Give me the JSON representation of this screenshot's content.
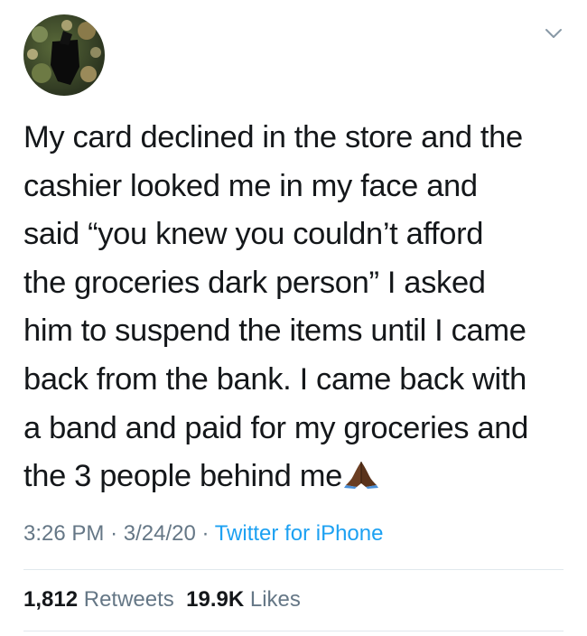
{
  "tweet": {
    "lines": [
      "My card declined in the store and the",
      "cashier looked me in my face and",
      "said “you knew you couldn’t afford",
      "the groceries dark person” I asked",
      "him to suspend the items until I came",
      "back from the bank. I came back with",
      "a band and paid for my groceries and",
      "the 3 people behind me"
    ],
    "emoji": "folded-hands-emoji"
  },
  "meta": {
    "time": "3:26 PM",
    "separator": "·",
    "date": "3/24/20",
    "source": "Twitter for iPhone"
  },
  "stats": {
    "retweets_count": "1,812",
    "retweets_label": "Retweets",
    "likes_count": "19.9K",
    "likes_label": "Likes"
  },
  "colors": {
    "text": "#14171a",
    "muted": "#657786",
    "link": "#1da1f2",
    "divider": "#e1e8ed"
  },
  "icons": [
    "avatar-image",
    "chevron-down-icon",
    "folded-hands-emoji"
  ]
}
